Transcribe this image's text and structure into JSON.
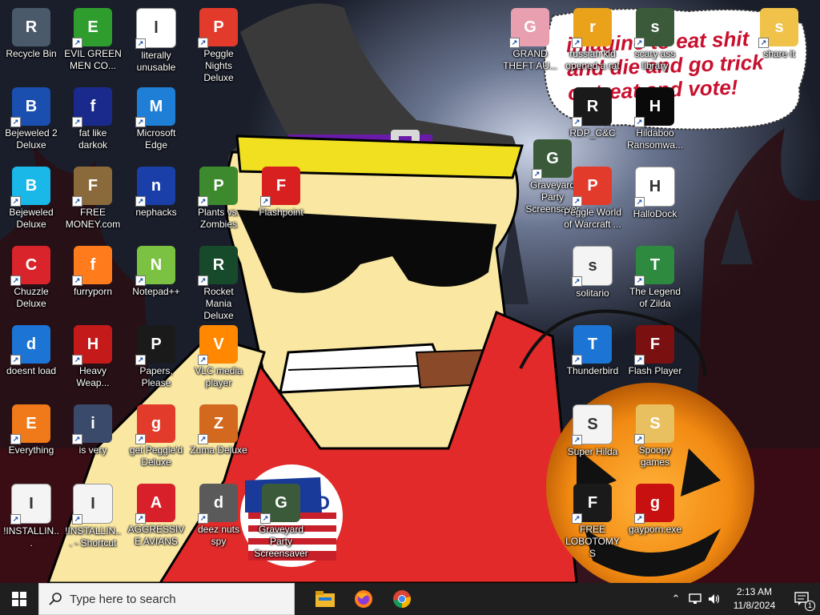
{
  "wallpaper": {
    "speech_line1": "imagine to eat shit",
    "speech_line2": "and die and go trick",
    "speech_line3": "or treat and vote!",
    "sign_text": "I VOTED"
  },
  "desktop_icons": [
    {
      "label": "Recycle Bin",
      "icon": "recycle-bin-icon",
      "color": "#4a5a6a"
    },
    {
      "label": "EVIL GREEN MEN CO...",
      "icon": "green-men-icon",
      "color": "#2e9d2e"
    },
    {
      "label": "literally unusable",
      "icon": "chrome-icon",
      "color": "#ffffff"
    },
    {
      "label": "Peggle Nights Deluxe",
      "icon": "peggle-icon",
      "color": "#e23b2b"
    },
    {
      "label": "Bejeweled 2 Deluxe",
      "icon": "bejeweled2-icon",
      "color": "#1a4fb0"
    },
    {
      "label": "fat like darkok",
      "icon": "mpi-icon",
      "color": "#1a2a8c"
    },
    {
      "label": "Microsoft Edge",
      "icon": "edge-icon",
      "color": "#1f7fd6"
    },
    {
      "label": "Bejeweled Deluxe",
      "icon": "diamond-icon",
      "color": "#19b8e8"
    },
    {
      "label": "FREE MONEY.com",
      "icon": "money-bag-icon",
      "color": "#8a6a3a"
    },
    {
      "label": "nephacks",
      "icon": "mpi-icon",
      "color": "#1a3fa8"
    },
    {
      "label": "Plants vs. Zombies",
      "icon": "pvz-icon",
      "color": "#3d8a2e"
    },
    {
      "label": "Flashpoint",
      "icon": "flashpoint-icon",
      "color": "#d92020"
    },
    {
      "label": "Chuzzle Deluxe",
      "icon": "chuzzle-icon",
      "color": "#d8242a"
    },
    {
      "label": "furryporn",
      "icon": "firefox-icon",
      "color": "#ff7b1c"
    },
    {
      "label": "Notepad++",
      "icon": "notepad-icon",
      "color": "#7cc242"
    },
    {
      "label": "Rocket Mania Deluxe",
      "icon": "rocket-icon",
      "color": "#174a2a"
    },
    {
      "label": "doesnt load",
      "icon": "thunderbird-icon",
      "color": "#1c74d4"
    },
    {
      "label": "Heavy Weap...",
      "icon": "radiation-icon",
      "color": "#c41a1a"
    },
    {
      "label": "Papers, Please",
      "icon": "papers-icon",
      "color": "#1a1a1a"
    },
    {
      "label": "VLC media player",
      "icon": "vlc-icon",
      "color": "#ff8800"
    },
    {
      "label": "Everything",
      "icon": "search-ring-icon",
      "color": "#f07a1a"
    },
    {
      "label": "is very",
      "icon": "shield-icon",
      "color": "#3a4a6a"
    },
    {
      "label": "get Peggle'd Deluxe",
      "icon": "peggle-icon",
      "color": "#e23b2b"
    },
    {
      "label": "Zuma Deluxe",
      "icon": "zuma-icon",
      "color": "#d2691e"
    },
    {
      "label": "!INSTALLIN...",
      "icon": "document-icon",
      "color": "#f4f4f4"
    },
    {
      "label": "!INSTALLIN... - Shortcut",
      "icon": "document-icon",
      "color": "#f4f4f4"
    },
    {
      "label": "AGGRESSIVE AVIANS",
      "icon": "angry-bird-icon",
      "color": "#d8202a"
    },
    {
      "label": "deez nuts spy",
      "icon": "windows-stack-icon",
      "color": "#5a5a5a"
    },
    {
      "label": "Graveyard Party Screensaver",
      "icon": "graveyard-icon",
      "color": "#3a5a3a"
    },
    {
      "label": "GRAND THEFT AU...",
      "icon": "anime-girl-icon",
      "color": "#e8a0b0"
    },
    {
      "label": "russian kid opened a rat",
      "icon": "de-icon",
      "color": "#e9a21a"
    },
    {
      "label": "scary ass library",
      "icon": "library-icon",
      "color": "#3a5a3a"
    },
    {
      "label": "share it",
      "icon": "folder-icon",
      "color": "#f0c24a"
    },
    {
      "label": "RDP_C&C",
      "icon": "rdp-icon",
      "color": "#1a1a1a"
    },
    {
      "label": "Hildaboo Ransomwa...",
      "icon": "yashma-icon",
      "color": "#0a0a0a"
    },
    {
      "label": "Graveyard Party Screensaver",
      "icon": "graveyard-icon",
      "color": "#3a5a3a"
    },
    {
      "label": "Peggle World of Warcraft ...",
      "icon": "peggle-icon",
      "color": "#e23b2b"
    },
    {
      "label": "HalloDock",
      "icon": "windows-logo-icon",
      "color": "#ffffff"
    },
    {
      "label": "solitario",
      "icon": "cards-icon",
      "color": "#f4f4f4"
    },
    {
      "label": "The Legend of Zilda",
      "icon": "zelda-icon",
      "color": "#2d8a3e"
    },
    {
      "label": "Thunderbird",
      "icon": "thunderbird-icon",
      "color": "#1c74d4"
    },
    {
      "label": "Flash Player",
      "icon": "flash-icon",
      "color": "#7a1010"
    },
    {
      "label": "Super Hilda",
      "icon": "pixel-dog-icon",
      "color": "#f4f4f4"
    },
    {
      "label": "Spoopy games",
      "icon": "spoopy-folder-icon",
      "color": "#e8c060"
    },
    {
      "label": "FREE LOBOTOMYS",
      "icon": "lobotomy-icon",
      "color": "#1a1a1a"
    },
    {
      "label": "gayporn.exe",
      "icon": "flash-icon",
      "color": "#c81010"
    }
  ],
  "taskbar": {
    "search_placeholder": "Type here to search",
    "pinned": [
      {
        "name": "File Explorer",
        "icon": "file-explorer-icon"
      },
      {
        "name": "Firefox",
        "icon": "firefox-icon"
      },
      {
        "name": "Chrome",
        "icon": "chrome-icon"
      }
    ],
    "time": "2:13 AM",
    "date": "11/8/2024",
    "notification_count": "1"
  }
}
